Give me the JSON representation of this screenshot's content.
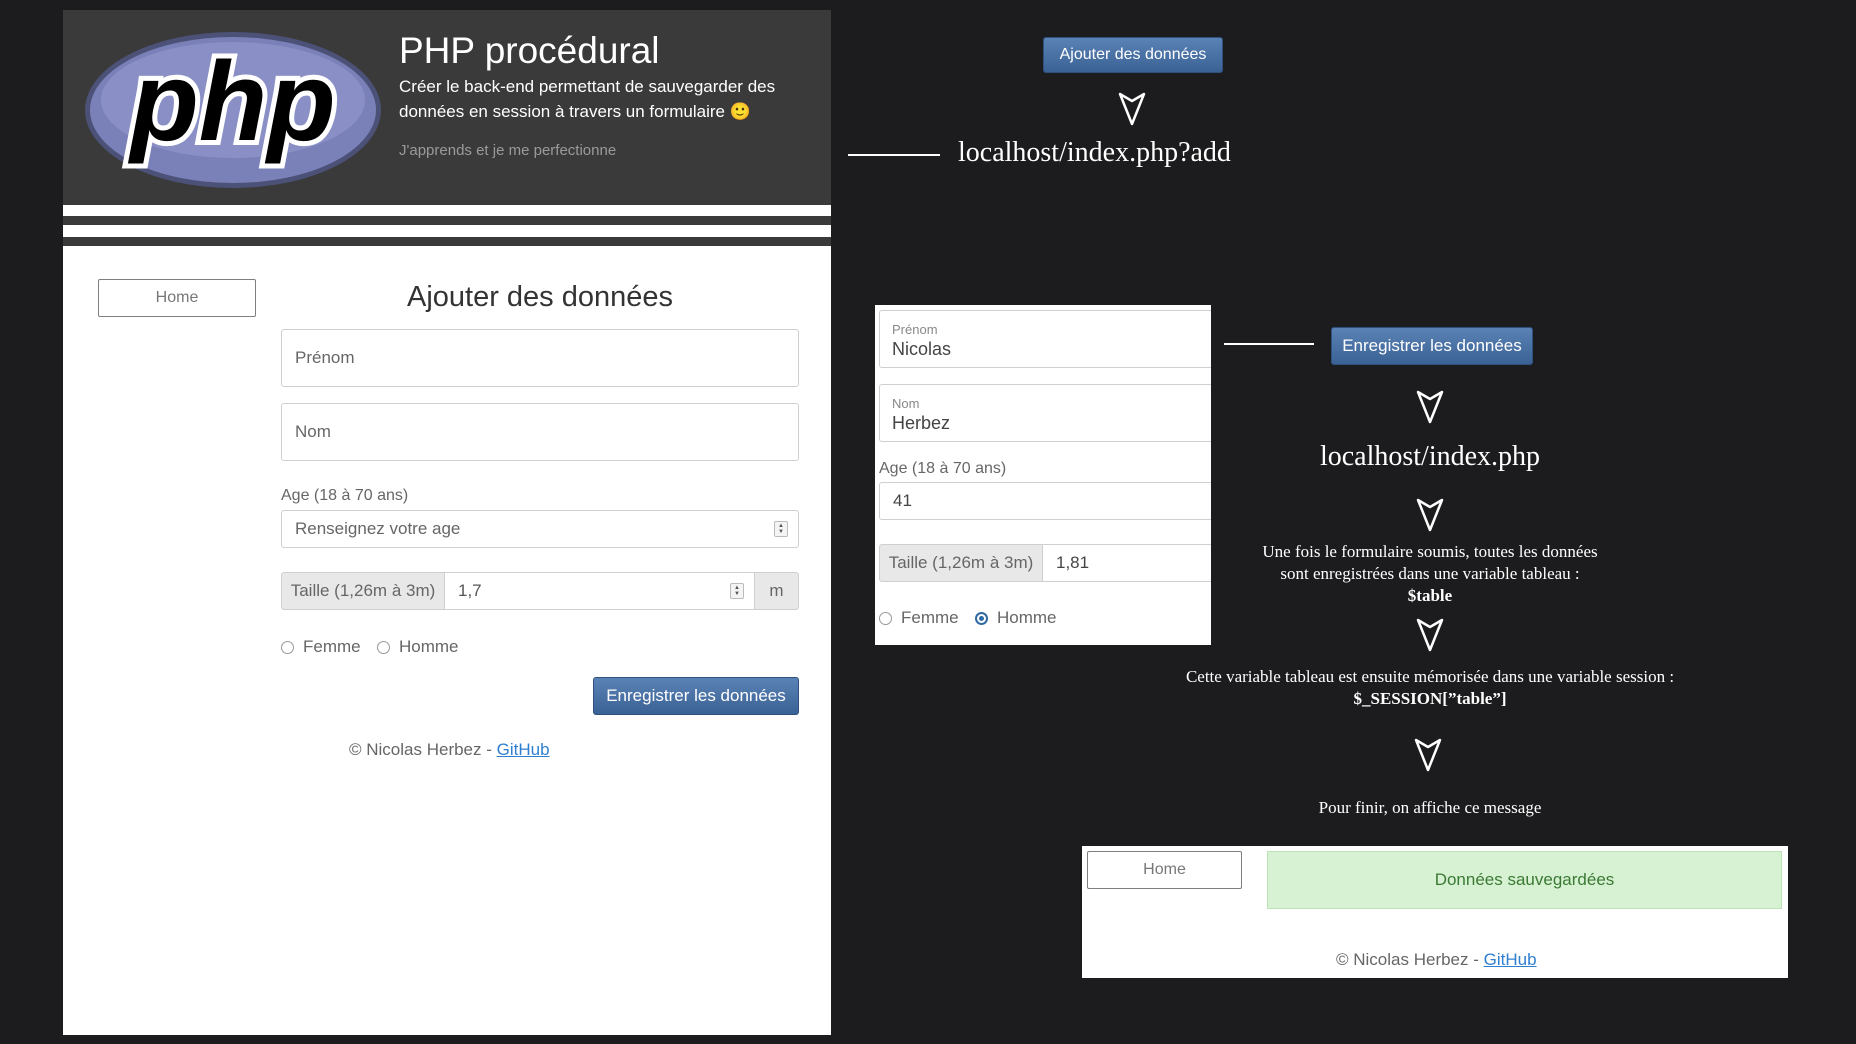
{
  "app": {
    "title": "PHP procédural",
    "description": "Créer le back-end permettant de sauvegarder des données en session à travers un formulaire 🙂",
    "motto": "J'apprends et je me perfectionne",
    "logo_text": "php",
    "nav": {
      "home_label": "Home"
    },
    "form": {
      "title": "Ajouter des données",
      "prenom_placeholder": "Prénom",
      "nom_placeholder": "Nom",
      "age_label": "Age (18 à 70 ans)",
      "age_placeholder": "Renseignez votre age",
      "taille_label": "Taille (1,26m à 3m)",
      "taille_value": "1,7",
      "taille_unit": "m",
      "gender_options": [
        "Femme",
        "Homme"
      ],
      "submit_label": "Enregistrer les données"
    },
    "footer": {
      "copyright": "© Nicolas Herbez - ",
      "link_label": "GitHub"
    }
  },
  "flow": {
    "add_button_label": "Ajouter des données",
    "url_add": "localhost/index.php?add",
    "filled_form": {
      "prenom_label": "Prénom",
      "prenom_value": "Nicolas",
      "nom_label": "Nom",
      "nom_value": "Herbez",
      "age_label": "Age (18 à 70 ans)",
      "age_value": "41",
      "taille_label": "Taille (1,26m à 3m)",
      "taille_value": "1,81",
      "gender_options": [
        "Femme",
        "Homme"
      ],
      "selected_gender": "Homme"
    },
    "save_button_label": "Enregistrer les données",
    "url_index": "localhost/index.php",
    "note1_line1": "Une fois le formulaire soumis, toutes les données",
    "note1_line2": "sont enregistrées dans une variable tableau :",
    "note1_var": "$table",
    "note2_line1": "Cette variable tableau est ensuite mémorisée dans une variable session :",
    "note2_var": "$_SESSION[”table”]",
    "note3": "Pour finir, on affiche ce message",
    "result": {
      "home_label": "Home",
      "alert": "Données sauvegardées",
      "copyright": "© Nicolas Herbez - ",
      "link_label": "GitHub"
    }
  },
  "colors": {
    "background": "#1c1c1e",
    "header": "#3a3a3a",
    "primary": "#3b6295",
    "success_bg": "#d7f1d3",
    "link": "#2f7fd0"
  },
  "icons": [
    "php-logo",
    "arrow-down-icon",
    "smiley-icon"
  ]
}
